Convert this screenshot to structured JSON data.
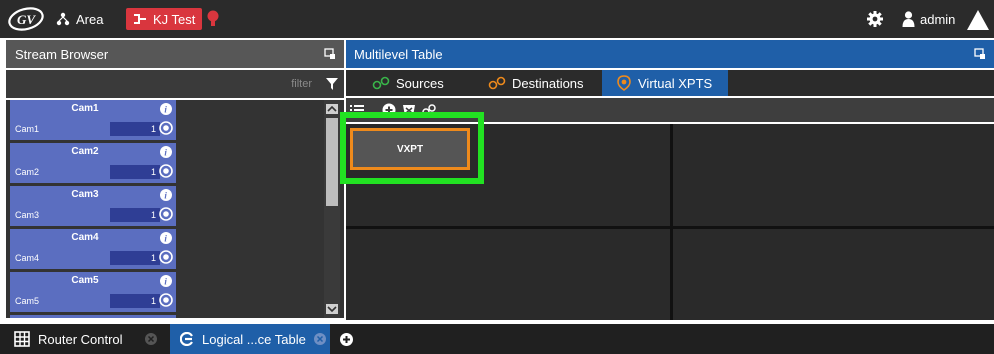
{
  "topbar": {
    "area_label": "Area",
    "kj_label": "KJ Test",
    "user_label": "admin",
    "accent_red": "#d9363e"
  },
  "stream_browser": {
    "title": "Stream Browser",
    "filter_placeholder": "filter",
    "streams": [
      {
        "title": "Cam1",
        "sub": "Cam1",
        "num": "1"
      },
      {
        "title": "Cam2",
        "sub": "Cam2",
        "num": "1"
      },
      {
        "title": "Cam3",
        "sub": "Cam3",
        "num": "1"
      },
      {
        "title": "Cam4",
        "sub": "Cam4",
        "num": "1"
      },
      {
        "title": "Cam5",
        "sub": "Cam5",
        "num": "1"
      }
    ]
  },
  "multilevel": {
    "title": "Multilevel Table",
    "tabs": [
      {
        "label": "Sources",
        "icon": "sources-icon"
      },
      {
        "label": "Destinations",
        "icon": "destinations-icon"
      },
      {
        "label": "Virtual XPTS",
        "icon": "virtual-xpts-icon",
        "active": true
      }
    ],
    "vxpt_label": "VXPT",
    "accent_blue": "#1f5fa8",
    "highlight_green": "#22e222",
    "highlight_orange": "#ee8a1c"
  },
  "bottom": {
    "tabs": [
      {
        "label": "Router Control"
      },
      {
        "label": "Logical ...ce Table",
        "active": true
      }
    ]
  }
}
